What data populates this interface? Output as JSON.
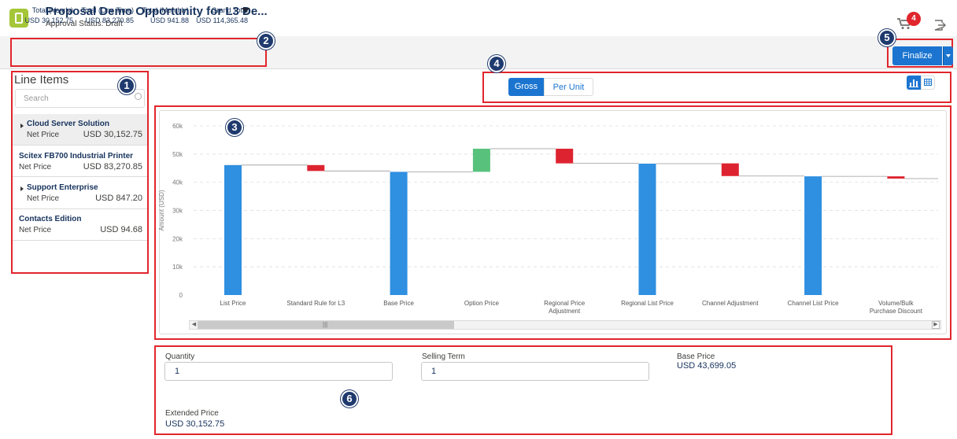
{
  "header": {
    "title": "Proposal Demo Opportunity for L3 De...",
    "subtitle": "Approval Status: Draft",
    "cart_count": "4"
  },
  "totals": [
    {
      "label": "Total (Yearly)",
      "value": "USD 30,152.75"
    },
    {
      "label": "Total (One Time)",
      "value": "USD 83,270.85"
    },
    {
      "label": "Total (Monthly)",
      "value": "USD 941.88"
    },
    {
      "label": "Grand Total",
      "value": "USD 114,365.48"
    }
  ],
  "finalize_label": "Finalize",
  "line_items": {
    "title": "Line Items",
    "search_placeholder": "Search",
    "items": [
      {
        "name": "Cloud Server Solution",
        "price_label": "Net Price",
        "price": "USD 30,152.75",
        "expandable": true,
        "selected": true
      },
      {
        "name": "Scitex FB700 Industrial Printer",
        "price_label": "Net Price",
        "price": "USD 83,270.85",
        "expandable": false,
        "selected": false
      },
      {
        "name": "Support Enterprise",
        "price_label": "Net Price",
        "price": "USD 847.20",
        "expandable": true,
        "selected": false
      },
      {
        "name": "Contacts Edition",
        "price_label": "Net Price",
        "price": "USD 94.68",
        "expandable": false,
        "selected": false
      }
    ]
  },
  "view_toggle": {
    "gross": "Gross",
    "per_unit": "Per Unit",
    "active": "Gross"
  },
  "chart_data": {
    "type": "waterfall",
    "ylabel": "Amount (USD)",
    "ylim": [
      0,
      60000
    ],
    "yticks": [
      "0",
      "10k",
      "20k",
      "30k",
      "40k",
      "50k",
      "60k"
    ],
    "categories": [
      "List Price",
      "Standard Rule for L3",
      "Base Price",
      "Option Price",
      "Regional Price Adjustment",
      "Regional List Price",
      "Channel Adjustment",
      "Channel List Price",
      "Volume/Bulk Purchase Discount"
    ],
    "bars": [
      {
        "kind": "total",
        "start": 0,
        "end": 46100
      },
      {
        "kind": "decrease",
        "start": 46100,
        "end": 44000
      },
      {
        "kind": "total",
        "start": 0,
        "end": 43700
      },
      {
        "kind": "increase",
        "start": 43700,
        "end": 51900
      },
      {
        "kind": "decrease",
        "start": 51900,
        "end": 46700
      },
      {
        "kind": "total",
        "start": 0,
        "end": 46600
      },
      {
        "kind": "decrease",
        "start": 46700,
        "end": 42200
      },
      {
        "kind": "total",
        "start": 0,
        "end": 42100
      },
      {
        "kind": "decrease",
        "start": 42100,
        "end": 41300
      }
    ],
    "colors": {
      "total": "#2f8fe0",
      "decrease": "#de2330",
      "increase": "#58c27d"
    },
    "grid": true
  },
  "details": {
    "quantity_label": "Quantity",
    "quantity_value": "1",
    "selling_term_label": "Selling Term",
    "selling_term_value": "1",
    "base_price_label": "Base Price",
    "base_price_value": "USD 43,699.05",
    "extended_price_label": "Extended Price",
    "extended_price_value": "USD 30,152.75"
  },
  "annotations": [
    "1",
    "2",
    "3",
    "4",
    "5",
    "6"
  ]
}
